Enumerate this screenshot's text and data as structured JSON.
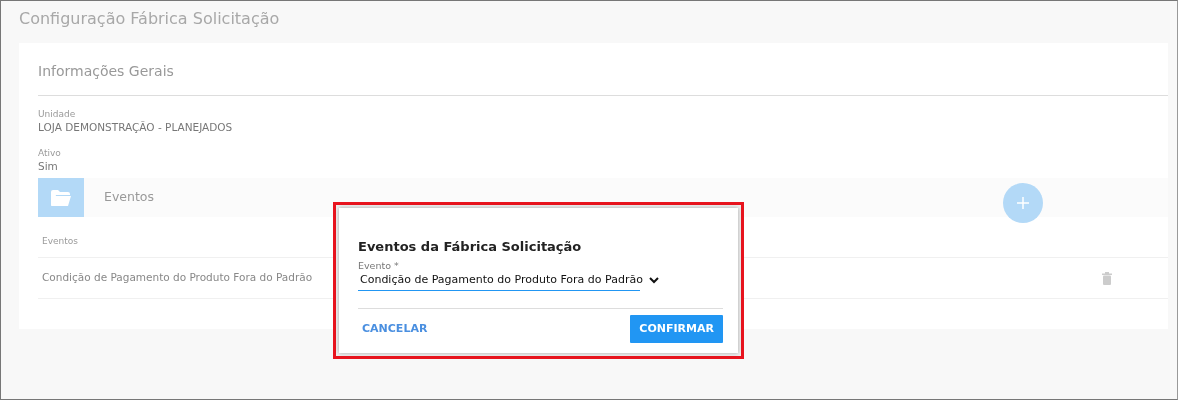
{
  "page_title": "Configuração Fábrica Solicitação",
  "section_title": "Informações Gerais",
  "fields": [
    {
      "label": "Unidade",
      "value": "LOJA DEMONSTRAÇÃO - PLANEJADOS"
    },
    {
      "label": "Ativo",
      "value": "Sim"
    }
  ],
  "events_panel": {
    "title": "Eventos",
    "columns": [
      "Eventos"
    ],
    "rows": [
      {
        "evento": "Condição de Pagamento do Produto Fora do Padrão"
      }
    ]
  },
  "modal": {
    "title": "Eventos da Fábrica Solicitação",
    "field": {
      "label": "Evento *",
      "value": "Condição de Pagamento do Produto Fora do Padrão"
    },
    "buttons": [
      {
        "label": "CANCELAR",
        "kind": "link"
      },
      {
        "label": "CONFIRMAR",
        "kind": "primary"
      }
    ]
  }
}
